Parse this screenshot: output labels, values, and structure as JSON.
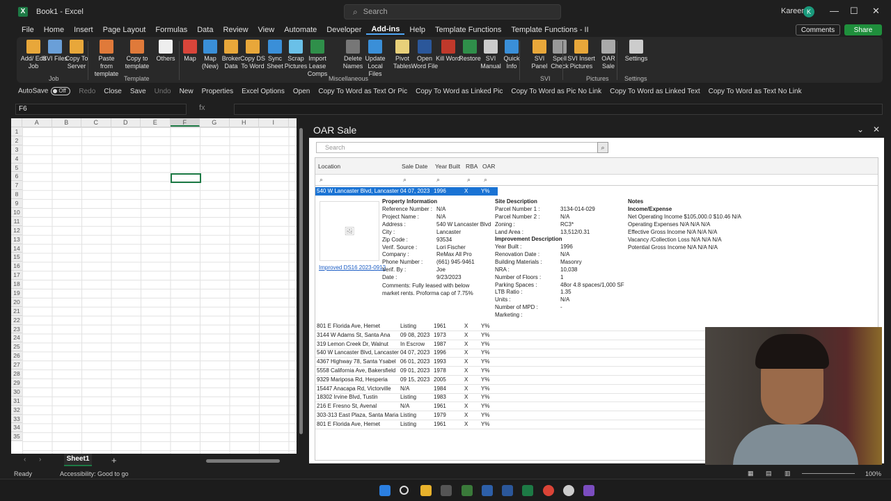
{
  "window": {
    "title": "Book1 - Excel",
    "search_placeholder": "Search",
    "user_name": "Kareem",
    "user_initial": "K"
  },
  "menu": {
    "items": [
      "File",
      "Home",
      "Insert",
      "Page Layout",
      "Formulas",
      "Data",
      "Review",
      "View",
      "Automate",
      "Developer",
      "Add-ins",
      "Help",
      "Template Functions",
      "Template Functions - II"
    ],
    "active": "Add-ins",
    "comments_label": "Comments",
    "share_label": "Share"
  },
  "ribbon": {
    "buttons": [
      {
        "label": "Add/ Edit Job",
        "icon": "folder-icon"
      },
      {
        "label": "SVI Files",
        "icon": "files-icon"
      },
      {
        "label": "Copy To Server",
        "icon": "folder-copy-icon"
      },
      {
        "label": "Paste from template",
        "icon": "paste-icon"
      },
      {
        "label": "Copy to template",
        "icon": "copy-template-icon"
      },
      {
        "label": "Others",
        "icon": "document-icon"
      },
      {
        "label": "Map",
        "icon": "map-icon"
      },
      {
        "label": "Map (New)",
        "icon": "map-new-icon"
      },
      {
        "label": "Broker Data",
        "icon": "broker-icon"
      },
      {
        "label": "Copy DS To Word",
        "icon": "copy-word-icon"
      },
      {
        "label": "Sync Sheet",
        "icon": "sync-icon"
      },
      {
        "label": "Scrap Pictures",
        "icon": "pictures-icon"
      },
      {
        "label": "Import Lease Comps",
        "icon": "import-icon"
      },
      {
        "label": "Delete Names",
        "icon": "delete-icon"
      },
      {
        "label": "Update Local Files",
        "icon": "update-icon"
      },
      {
        "label": "Pivot Tables",
        "icon": "pivot-icon"
      },
      {
        "label": "Open Word File",
        "icon": "word-icon"
      },
      {
        "label": "Kill Word",
        "icon": "kill-word-icon"
      },
      {
        "label": "Restore",
        "icon": "restore-icon"
      },
      {
        "label": "SVI Manual",
        "icon": "manual-icon"
      },
      {
        "label": "Quick Info",
        "icon": "info-icon"
      },
      {
        "label": "SVI Panel",
        "icon": "panel-icon"
      },
      {
        "label": "Spell Check",
        "icon": "spell-icon"
      },
      {
        "label": "SVI Insert Pictures",
        "icon": "insert-pictures-icon"
      },
      {
        "label": "OAR Sale",
        "icon": "oar-icon"
      },
      {
        "label": "Settings",
        "icon": "gear-icon"
      }
    ],
    "groups": [
      "Job",
      "Template",
      "Miscellaneous",
      "SVI",
      "Pictures",
      "Settings"
    ]
  },
  "qat": {
    "autosave": "AutoSave",
    "autosave_state": "Off",
    "items": [
      "Redo",
      "Close",
      "Save",
      "Undo",
      "New",
      "Properties",
      "Excel Options",
      "Open",
      "Copy To Word as Text Or Pic",
      "Copy To Word as Linked Pic",
      "Copy To Word as Pic No Link",
      "Copy To Word as Linked Text",
      "Copy To Word as Text No Link"
    ]
  },
  "formula_bar": {
    "name_box": "F6",
    "fx": "fx"
  },
  "sheet": {
    "columns": [
      "A",
      "B",
      "C",
      "D",
      "E",
      "F",
      "G",
      "H",
      "I"
    ],
    "rows": [
      "1",
      "2",
      "3",
      "4",
      "5",
      "6",
      "7",
      "8",
      "9",
      "10",
      "11",
      "12",
      "13",
      "14",
      "15",
      "16",
      "17",
      "18",
      "19",
      "20",
      "21",
      "22",
      "23",
      "24",
      "25",
      "26",
      "27",
      "28",
      "29",
      "30",
      "31",
      "32",
      "33",
      "34",
      "35"
    ],
    "selected_cell": "F6",
    "tab": "Sheet1"
  },
  "status": {
    "ready": "Ready",
    "accessibility": "Accessibility: Good to go",
    "zoom": "100%"
  },
  "pane": {
    "title": "OAR Sale",
    "search_placeholder": "Search",
    "headers": [
      "Location",
      "Sale Date",
      "Year Built",
      "RBA",
      "OAR"
    ],
    "selected": {
      "location": "540 W Lancaster Blvd, Lancaster",
      "date": "04 07, 2023",
      "year": "1996",
      "rba": "X",
      "oar": "Y%"
    },
    "image_link": "Improved DS16 2023-0912",
    "property": {
      "title": "Property Information",
      "fields": [
        [
          "Reference Number :",
          "N/A"
        ],
        [
          "Project Name :",
          "N/A"
        ],
        [
          "Address :",
          "540 W Lancaster Blvd"
        ],
        [
          "City :",
          "Lancaster"
        ],
        [
          "Zip Code :",
          "93534"
        ],
        [
          "Verif. Source :",
          "Lori Fischer"
        ],
        [
          "Company :",
          "ReMax All Pro"
        ],
        [
          "Phone Number :",
          "(661) 945-9461"
        ],
        [
          "Verif. By :",
          "Joe"
        ],
        [
          "Date :",
          "9/23/2023"
        ]
      ],
      "comments": "Comments:  Fully leased with below market rents.  Proforma cap of 7.75%"
    },
    "site": {
      "title": "Site Description",
      "fields": [
        [
          "Parcel Number 1 :",
          "3134-014-029"
        ],
        [
          "Parcel Number 2 :",
          "N/A"
        ],
        [
          "Zoning :",
          "RC3*"
        ],
        [
          "Land Area :",
          "13,512/0.31"
        ]
      ]
    },
    "improvement": {
      "title": "Improvement Description",
      "fields": [
        [
          "Year Built :",
          "1996"
        ],
        [
          "Renovation Date :",
          "N/A"
        ],
        [
          "Building Materials :",
          "Masonry"
        ],
        [
          "NRA :",
          "10,038"
        ],
        [
          "Number of Floors :",
          "1"
        ],
        [
          "Parking Spaces :",
          "48or 4.8 spaces/1,000 SF"
        ],
        [
          "LTB Ratio :",
          "1.35"
        ],
        [
          "Units :",
          "N/A"
        ],
        [
          "Number of MPD :",
          "-"
        ],
        [
          "Marketing :",
          ""
        ]
      ]
    },
    "notes": {
      "title": "Notes",
      "subtitle": "Income/Expense",
      "lines": [
        "Net Operating Income $105,000.0 $10.46 N/A",
        "Operating Expenses N/A N/A N/A",
        "Effective Gross Income N/A N/A N/A",
        "Vacancy /Collection Loss N/A N/A N/A",
        "Potential Gross Income N/A N/A N/A"
      ]
    },
    "rows": [
      [
        "801 E Florida Ave, Hemet",
        "Listing",
        "1961",
        "X",
        "Y%"
      ],
      [
        "3144 W Adams St, Santa Ana",
        "09 08, 2023",
        "1973",
        "X",
        "Y%"
      ],
      [
        "319 Lemon Creek Dr, Walnut",
        "In Escrow",
        "1987",
        "X",
        "Y%"
      ],
      [
        "540 W Lancaster Blvd, Lancaster",
        "04 07, 2023",
        "1996",
        "X",
        "Y%"
      ],
      [
        "4367 Highway 78, Santa Ysabel",
        "06 01, 2023",
        "1993",
        "X",
        "Y%"
      ],
      [
        "5558 California Ave, Bakersfield",
        "09 01, 2023",
        "1978",
        "X",
        "Y%"
      ],
      [
        "9329 Mariposa Rd, Hesperia",
        "09 15, 2023",
        "2005",
        "X",
        "Y%"
      ],
      [
        "15447 Anacapa Rd, Victorville",
        "N/A",
        "1984",
        "X",
        "Y%"
      ],
      [
        "18302 Irvine Blvd, Tustin",
        "Listing",
        "1983",
        "X",
        "Y%"
      ],
      [
        "216 E Fresno St, Avenal",
        "N/A",
        "1961",
        "X",
        "Y%"
      ],
      [
        "303-313 East Plaza, Santa Maria",
        "Listing",
        "1979",
        "X",
        "Y%"
      ],
      [
        "801 E Florida Ave, Hemet",
        "Listing",
        "1961",
        "X",
        "Y%"
      ]
    ]
  }
}
